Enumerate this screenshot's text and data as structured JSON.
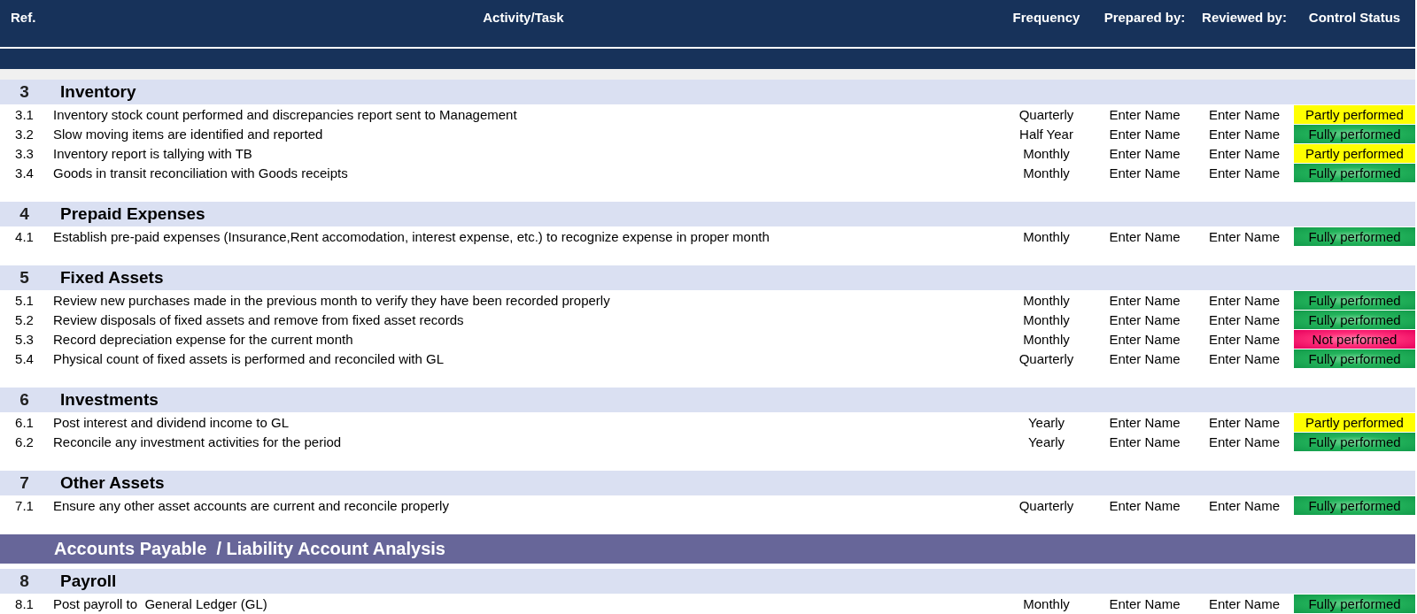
{
  "header": {
    "columns": [
      "Ref.",
      "Activity/Task",
      "Frequency",
      "Prepared by:",
      "Reviewed by:",
      "Control Status"
    ]
  },
  "blocks": [
    {
      "kind": "section",
      "number": "3",
      "title": "Inventory",
      "rows": [
        {
          "ref": "3.1",
          "task": "Inventory stock count performed and discrepancies report sent to Management",
          "frequency": "Quarterly",
          "prepared_by": "Enter Name",
          "reviewed_by": "Enter Name",
          "status": {
            "text": "Partly performed",
            "kind": "partly"
          }
        },
        {
          "ref": "3.2",
          "task": "Slow moving items are identified and reported",
          "frequency": "Half Year",
          "prepared_by": "Enter Name",
          "reviewed_by": "Enter Name",
          "status": {
            "text": "Fully performed",
            "kind": "fully"
          }
        },
        {
          "ref": "3.3",
          "task": "Inventory report is tallying with TB",
          "frequency": "Monthly",
          "prepared_by": "Enter Name",
          "reviewed_by": "Enter Name",
          "status": {
            "text": "Partly performed",
            "kind": "partly"
          }
        },
        {
          "ref": "3.4",
          "task": "Goods in transit reconciliation with Goods receipts",
          "frequency": "Monthly",
          "prepared_by": "Enter Name",
          "reviewed_by": "Enter Name",
          "status": {
            "text": "Fully performed",
            "kind": "fully"
          }
        }
      ]
    },
    {
      "kind": "section",
      "number": "4",
      "title": "Prepaid Expenses",
      "rows": [
        {
          "ref": "4.1",
          "task": "Establish pre-paid expenses (Insurance,Rent accomodation, interest expense, etc.) to recognize expense in proper month",
          "frequency": "Monthly",
          "prepared_by": "Enter Name",
          "reviewed_by": "Enter Name",
          "status": {
            "text": "Fully performed",
            "kind": "fully"
          }
        }
      ]
    },
    {
      "kind": "section",
      "number": "5",
      "title": "Fixed Assets",
      "rows": [
        {
          "ref": "5.1",
          "task": "Review new purchases made in the previous month to verify they have been recorded properly",
          "frequency": "Monthly",
          "prepared_by": "Enter Name",
          "reviewed_by": "Enter Name",
          "status": {
            "text": "Fully performed",
            "kind": "fully"
          }
        },
        {
          "ref": "5.2",
          "task": "Review disposals of fixed assets and remove from fixed asset records",
          "frequency": "Monthly",
          "prepared_by": "Enter Name",
          "reviewed_by": "Enter Name",
          "status": {
            "text": "Fully performed",
            "kind": "fully"
          }
        },
        {
          "ref": "5.3",
          "task": "Record depreciation expense for the current month",
          "frequency": "Monthly",
          "prepared_by": "Enter Name",
          "reviewed_by": "Enter Name",
          "status": {
            "text": "Not performed",
            "kind": "not"
          }
        },
        {
          "ref": "5.4",
          "task": "Physical count of fixed assets is performed and reconciled with GL",
          "frequency": "Quarterly",
          "prepared_by": "Enter Name",
          "reviewed_by": "Enter Name",
          "status": {
            "text": "Fully performed",
            "kind": "fully"
          }
        }
      ]
    },
    {
      "kind": "section",
      "number": "6",
      "title": "Investments",
      "rows": [
        {
          "ref": "6.1",
          "task": "Post interest and dividend income to GL",
          "frequency": "Yearly",
          "prepared_by": "Enter Name",
          "reviewed_by": "Enter Name",
          "status": {
            "text": "Partly performed",
            "kind": "partly"
          }
        },
        {
          "ref": "6.2",
          "task": "Reconcile any investment activities for the period",
          "frequency": "Yearly",
          "prepared_by": "Enter Name",
          "reviewed_by": "Enter Name",
          "status": {
            "text": "Fully performed",
            "kind": "fully"
          }
        }
      ]
    },
    {
      "kind": "section",
      "number": "7",
      "title": "Other Assets",
      "rows": [
        {
          "ref": "7.1",
          "task": "Ensure any other asset accounts are current and reconcile properly",
          "frequency": "Quarterly",
          "prepared_by": "Enter Name",
          "reviewed_by": "Enter Name",
          "status": {
            "text": "Fully performed",
            "kind": "fully"
          }
        }
      ]
    },
    {
      "kind": "category",
      "title": "Accounts Payable  / Liability Account Analysis"
    },
    {
      "kind": "section",
      "number": "8",
      "title": "Payroll",
      "rows": [
        {
          "ref": "8.1",
          "task": "Post payroll to  General Ledger (GL)",
          "frequency": "Monthly",
          "prepared_by": "Enter Name",
          "reviewed_by": "Enter Name",
          "status": {
            "text": "Fully performed",
            "kind": "fully"
          }
        }
      ]
    }
  ]
}
